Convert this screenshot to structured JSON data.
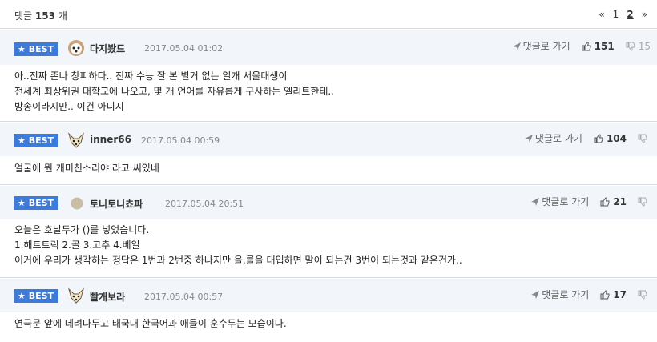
{
  "header": {
    "label": "댓글",
    "count": "153",
    "unit": "개",
    "pager": {
      "first": "«",
      "pages": [
        "1",
        "2"
      ],
      "current": "2",
      "last": "»"
    }
  },
  "badge_label": "BEST",
  "reply_label": "댓글로 가기",
  "comments": [
    {
      "nickname": "다지봤드",
      "date": "2017.05.04 01:02",
      "likes": "151",
      "dislikes": "15",
      "lines": [
        "아..진짜 존나 창피하다.. 진짜 수능 잘 본 별거 없는 일개 서울대생이",
        "전세계 최상위권 대학교에 나오고, 몇 개 언어를 자유롭게 구사하는 엘리트한테..",
        "방송이라지만.. 이건 아니지"
      ]
    },
    {
      "nickname": "inner66",
      "date": "2017.05.04 00:59",
      "likes": "104",
      "dislikes": "",
      "lines": [
        "얼굴에 뭔 개미친소리야 라고 써있네"
      ]
    },
    {
      "nickname": "토니토니쵸파",
      "date": "2017.05.04 20:51",
      "likes": "21",
      "dislikes": "",
      "lines": [
        "오늘은 호날두가 ()를 넣었습니다.",
        "1.해트트릭 2.골 3.고추 4.베일",
        "이거에 우리가 생각하는 정답은 1번과 2번중 하나지만 을,를을 대입하면 말이 되는건 3번이 되는것과 같은건가.."
      ]
    },
    {
      "nickname": "빨개보라",
      "date": "2017.05.04 00:57",
      "likes": "17",
      "dislikes": "",
      "lines": [
        "연극문 앞에 데려다두고 태국대 한국어과 애들이 훈수두는 모습이다."
      ]
    }
  ]
}
